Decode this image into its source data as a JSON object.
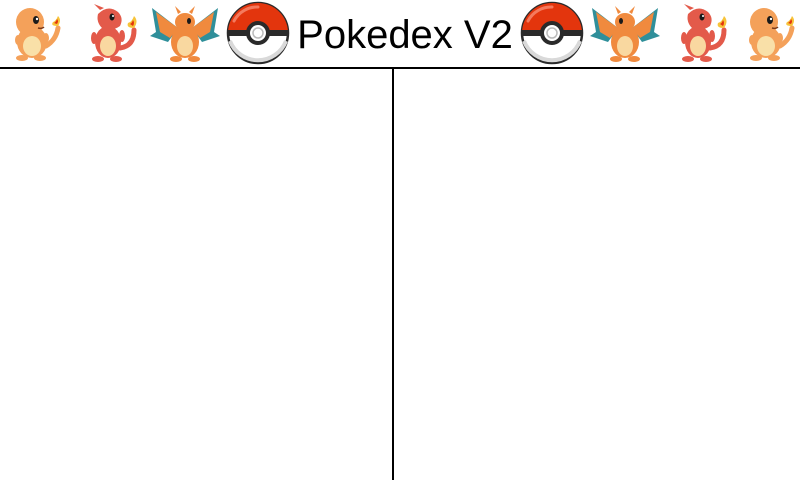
{
  "header": {
    "title": "Pokedex V2",
    "sprites_left": [
      "charmander-icon",
      "charmeleon-icon",
      "charizard-icon",
      "pokeball-icon"
    ],
    "sprites_right": [
      "pokeball-icon",
      "charizard-icon",
      "charmeleon-icon",
      "charmander-icon"
    ]
  },
  "colors": {
    "background": "#ffffff",
    "divider": "#000000",
    "pokeball_red": "#e3350d",
    "charmander_orange": "#f4a15a",
    "charmeleon_red": "#e35a4a",
    "charizard_orange": "#f08a3e",
    "charizard_wing": "#2f8f9a"
  },
  "panels": {
    "left": {},
    "right": {}
  }
}
